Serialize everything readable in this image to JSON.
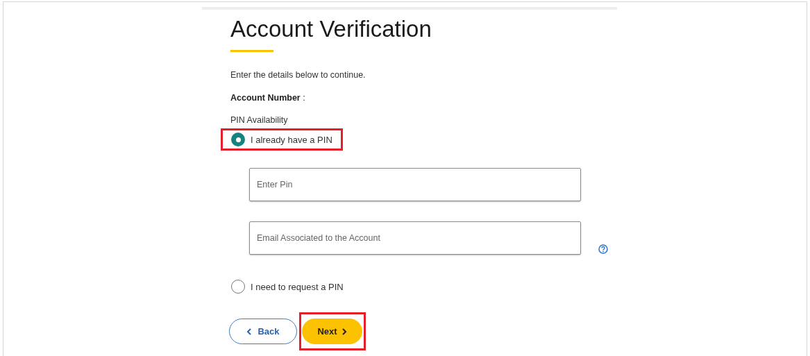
{
  "title": "Account Verification",
  "intro": "Enter the details below to continue.",
  "account_number": {
    "label": "Account Number",
    "separator": ":"
  },
  "pin_availability": {
    "label": "PIN Availability",
    "options": [
      {
        "label": "I already have a PIN",
        "selected": true,
        "highlighted": true
      },
      {
        "label": "I need to request a PIN",
        "selected": false,
        "highlighted": false
      }
    ]
  },
  "fields": [
    {
      "placeholder": "Enter Pin",
      "help": false
    },
    {
      "placeholder": "Email Associated to the Account",
      "help": true
    }
  ],
  "buttons": [
    {
      "kind": "back",
      "label": "Back",
      "highlighted": false
    },
    {
      "kind": "next",
      "label": "Next",
      "highlighted": true
    }
  ]
}
